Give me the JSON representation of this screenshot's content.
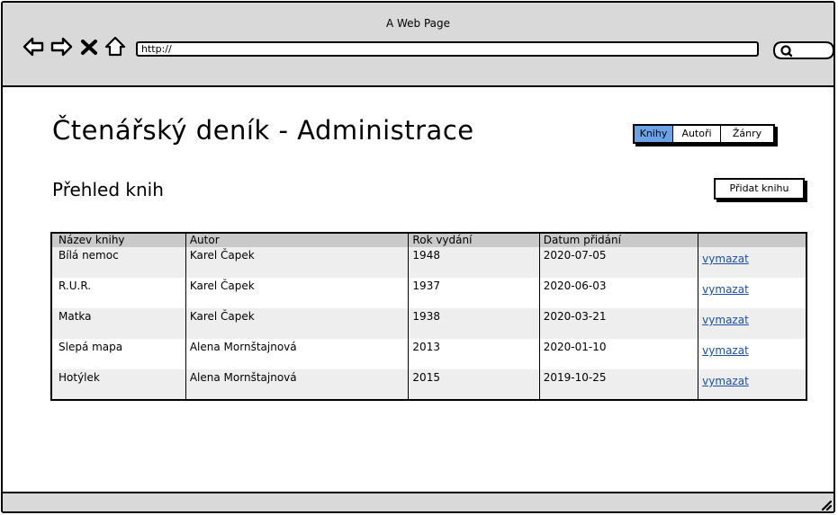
{
  "window": {
    "title": "A Web Page",
    "address": "http://"
  },
  "icons": {
    "back": "back-arrow-icon",
    "forward": "forward-arrow-icon",
    "stop": "close-icon",
    "home": "home-icon",
    "search": "search-icon",
    "resize": "resize-grip-icon"
  },
  "header": {
    "title": "Čtenářský deník - Administrace"
  },
  "tabs": [
    {
      "label": "Knihy",
      "active": true
    },
    {
      "label": "Autoři",
      "active": false
    },
    {
      "label": "Žánry",
      "active": false
    }
  ],
  "section": {
    "title": "Přehled knih",
    "add_button": "Přidat knihu"
  },
  "table": {
    "columns": [
      "Název knihy",
      "Autor",
      "Rok vydání",
      "Datum přidání",
      ""
    ],
    "rows": [
      {
        "title": "Bílá nemoc",
        "author": "Karel Čapek",
        "year": "1948",
        "added": "2020-07-05",
        "action": "vymazat"
      },
      {
        "title": "R.U.R.",
        "author": "Karel Čapek",
        "year": "1937",
        "added": "2020-06-03",
        "action": "vymazat"
      },
      {
        "title": "Matka",
        "author": "Karel Čapek",
        "year": "1938",
        "added": "2020-03-21",
        "action": "vymazat"
      },
      {
        "title": "Slepá mapa",
        "author": "Alena Mornštajnová",
        "year": "2013",
        "added": "2020-01-10",
        "action": "vymazat"
      },
      {
        "title": "Hotýlek",
        "author": "Alena Mornštajnová",
        "year": "2015",
        "added": "2019-10-25",
        "action": "vymazat"
      }
    ]
  },
  "colors": {
    "chrome": "#d9d9d9",
    "active_tab": "#6ba3e6",
    "link": "#1a4fa8",
    "table_header": "#c9c9c9",
    "row_stripe": "#eeeeee"
  }
}
